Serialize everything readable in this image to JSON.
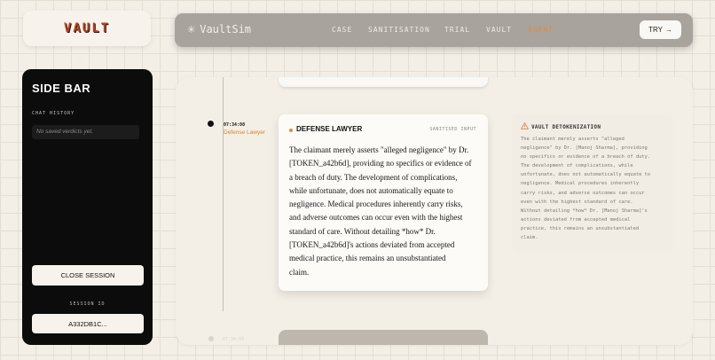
{
  "logo": {
    "text": "VAULT"
  },
  "nav": {
    "brand_icon": "✳",
    "brand_name": "VaultSim",
    "links": [
      "CASE",
      "SANITISATION",
      "TRIAL",
      "VAULT",
      "AGENT"
    ],
    "active_index": 4,
    "try_label": "TRY",
    "try_arrow": "→"
  },
  "sidebar": {
    "title": "SIDE BAR",
    "chat_history_label": "CHAT HISTORY",
    "empty_text": "No saved verdicts yet.",
    "close_session_label": "CLOSE SESSION",
    "session_id_label": "SESSION ID",
    "session_id_value": "A332DB1C..."
  },
  "timeline": {
    "time": "07:34:08",
    "role": "Defense Lawyer",
    "next_label": "07:34:09"
  },
  "message": {
    "speaker": "DEFENSE LAWYER",
    "tag": "SANITISED INPUT",
    "lines": [
      "The claimant merely asserts \"alleged negligence\" by Dr.",
      "[TOKEN_a42b6d], providing no specifics or evidence of",
      "a breach of duty. The development of complications,",
      "while unfortunate, does not automatically equate to",
      "negligence. Medical procedures inherently carry risks,",
      "and adverse outcomes can occur even with the highest",
      "standard of care. Without detailing *how* Dr.",
      "[TOKEN_a42b6d]'s actions deviated from accepted",
      "medical practice, this remains an unsubstantiated",
      "claim."
    ]
  },
  "detokenization": {
    "title": "VAULT DETOKENIZATION",
    "lines": [
      "The claimant merely asserts \"alleged",
      "negligence\" by Dr. [Manoj Sharma], providing",
      "no specifics or evidence of a breach of duty.",
      "The development of complications, while",
      "unfortunate, does not automatically equate to",
      "negligence. Medical procedures inherently",
      "carry risks, and adverse outcomes can occur",
      "even with the highest standard of care.",
      "Without detailing *how* Dr. [Manoj Sharma]'s",
      "actions deviated from accepted medical",
      "practice, this remains an unsubstantiated",
      "claim."
    ]
  },
  "colors": {
    "accent": "#e08a45",
    "sidebar_bg": "#0c0c0c",
    "nav_bg": "#a8a39c"
  }
}
